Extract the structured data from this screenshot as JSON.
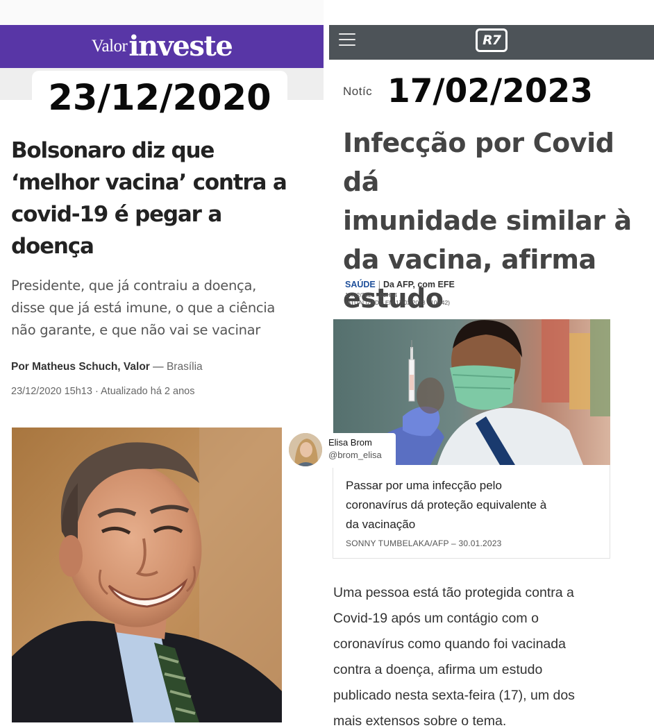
{
  "left": {
    "logo_valor": "Valor",
    "logo_investe": "investe",
    "date_overlay": "23/12/2020",
    "headline_lines": [
      "Bolsonaro diz que",
      "‘melhor vacina’ contra a",
      "covid-19 é pegar a",
      "doença"
    ],
    "subtitle_lines": [
      "Presidente, que já contraiu a doença,",
      "disse que já está imune, o que a ciência",
      "não garante, e que não vai se vacinar"
    ],
    "byline_author": "Por Matheus Schuch, Valor",
    "byline_dash": " — ",
    "byline_location": "Brasília",
    "published": "23/12/2020 15h13 · Atualizado há 2 anos"
  },
  "right": {
    "logo": "R7",
    "section_partial": "Notíc",
    "date_overlay": "17/02/2023",
    "headline_lines": [
      "Infecção por Covid dá",
      "imunidade similar à",
      "da vacina, afirma",
      "estudo"
    ],
    "section": "SAÚDE",
    "separator": "|",
    "source": "Da AFP, com EFE",
    "time_published": "17/02/2023 - 09H54",
    "time_updated": "(ATUALIZADO EM 17/02/2023 - 10H42)",
    "caption_lines": [
      "Passar por uma infecção pelo",
      "coronavírus dá proteção equivalente à",
      "da vacinação"
    ],
    "photo_credit": "SONNY TUMBELAKA/AFP – 30.01.2023",
    "body_lines": [
      "Uma pessoa está tão protegida contra a",
      "Covid-19 após um contágio com o",
      "coronavírus como quando foi vacinada",
      "contra a doença, afirma um estudo",
      "publicado nesta sexta-feira (17), um dos",
      "mais extensos sobre o tema."
    ]
  },
  "watermark": {
    "name": "Elisa Brom",
    "handle": "@brom_elisa"
  },
  "colors": {
    "valor_purple": "#5836a6",
    "r7_bar": "#4d5358",
    "section_blue": "#1e4f9a"
  }
}
